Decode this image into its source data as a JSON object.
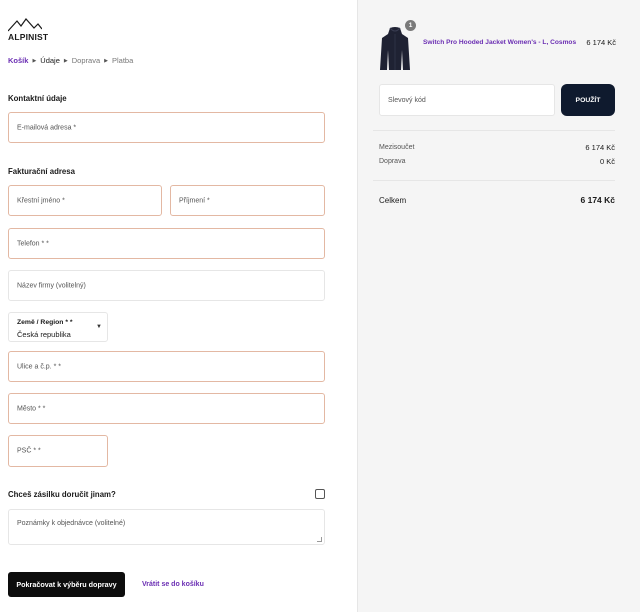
{
  "brand": {
    "logo_text": "ALPINIST",
    "logo_icon": "mountain-icon"
  },
  "breadcrumb": {
    "items": [
      "Košík",
      "Údaje",
      "Doprava",
      "Platba"
    ]
  },
  "contact": {
    "title": "Kontaktní údaje",
    "email_placeholder": "E-mailová adresa *"
  },
  "billing": {
    "title": "Fakturační adresa",
    "first_name_placeholder": "Křestní jméno *",
    "last_name_placeholder": "Příjmení *",
    "phone_placeholder": "Telefon * *",
    "company_placeholder": "Název firmy (volitelný)",
    "country_label": "Země / Region * *",
    "country_value": "Česká republika",
    "street_placeholder": "Ulice a č.p. * *",
    "city_placeholder": "Město * *",
    "zip_placeholder": "PSČ * *"
  },
  "shipping": {
    "question": "Chceš zásilku doručit jinam?",
    "notes_placeholder": "Poznámky k objednávce (volitelné)"
  },
  "actions": {
    "continue_label": "Pokračovat k výběru dopravy",
    "back_label": "Vrátit se do košíku"
  },
  "summary": {
    "product": {
      "name": "Switch Pro Hooded Jacket Women's - L, Cosmos",
      "price": "6 174 Kč",
      "quantity": "1"
    },
    "coupon_placeholder": "Slevový kód",
    "apply_label": "POUŽÍT",
    "subtotal_label": "Mezisoučet",
    "subtotal_value": "6 174 Kč",
    "shipping_label": "Doprava",
    "shipping_value": "0 Kč",
    "total_label": "Celkem",
    "total_value": "6 174 Kč"
  },
  "colors": {
    "accent": "#6b2fb3",
    "field_border_required": "#e3b8a3",
    "button_dark": "#0d0d0d",
    "apply_button": "#0f1a2e",
    "summary_bg": "#f5f5f5"
  }
}
